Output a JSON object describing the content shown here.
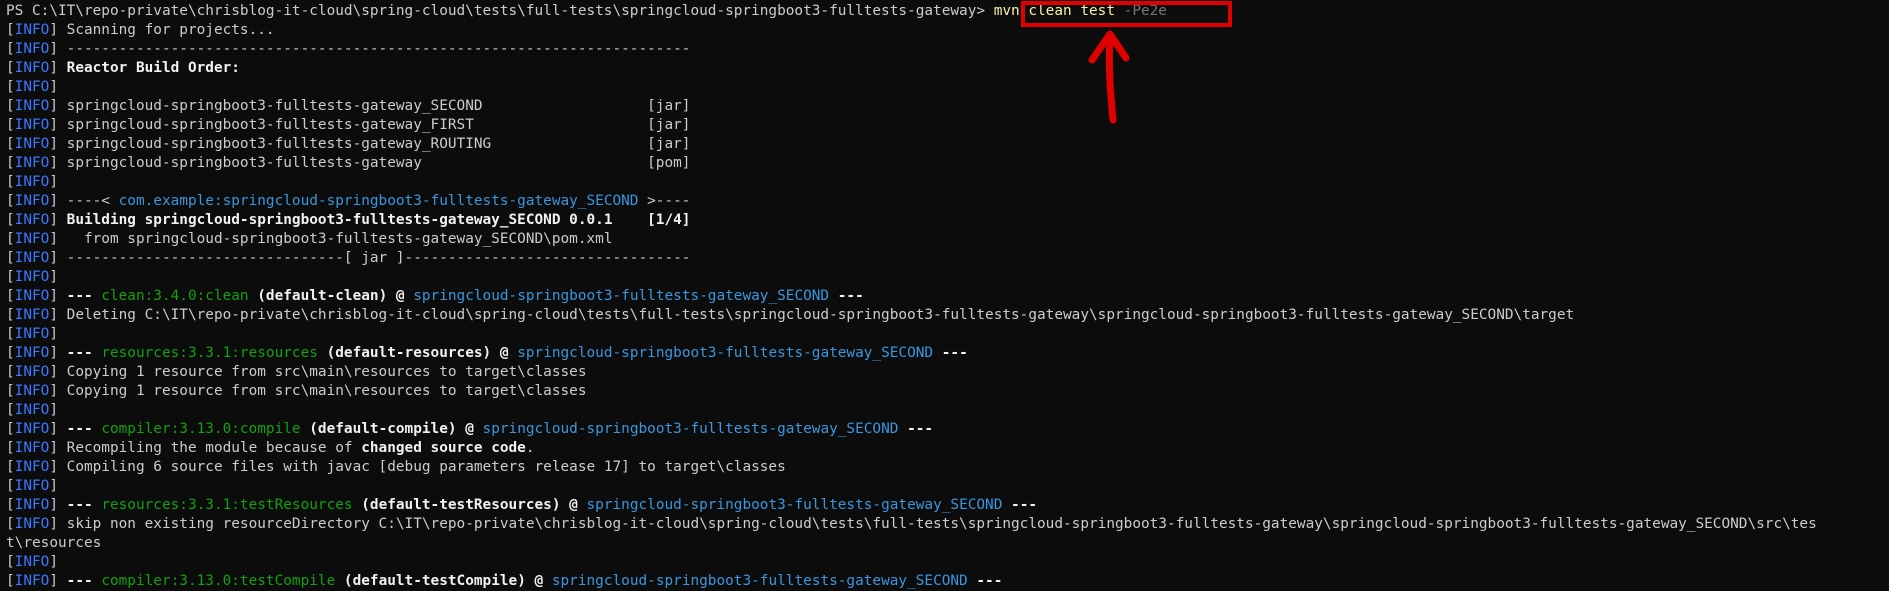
{
  "terminal": {
    "lines": [
      [
        {
          "t": "PS C:\\IT\\repo-private\\chrisblog-it-cloud\\spring-cloud\\tests\\full-tests\\springcloud-springboot3-fulltests-gateway> ",
          "c": "plain"
        },
        {
          "t": "mvn clean test ",
          "c": "cmd"
        },
        {
          "t": "-Pe2e",
          "c": "dim"
        }
      ],
      [
        {
          "t": "[",
          "c": "plain"
        },
        {
          "t": "INFO",
          "c": "info"
        },
        {
          "t": "] Scanning for projects...",
          "c": "plain"
        }
      ],
      [
        {
          "t": "[",
          "c": "plain"
        },
        {
          "t": "INFO",
          "c": "info"
        },
        {
          "t": "] ------------------------------------------------------------------------",
          "c": "plain"
        }
      ],
      [
        {
          "t": "[",
          "c": "plain"
        },
        {
          "t": "INFO",
          "c": "info"
        },
        {
          "t": "] ",
          "c": "plain"
        },
        {
          "t": "Reactor Build Order:",
          "c": "bold"
        }
      ],
      [
        {
          "t": "[",
          "c": "plain"
        },
        {
          "t": "INFO",
          "c": "info"
        },
        {
          "t": "]",
          "c": "plain"
        }
      ],
      [
        {
          "t": "[",
          "c": "plain"
        },
        {
          "t": "INFO",
          "c": "info"
        },
        {
          "t": "] springcloud-springboot3-fulltests-gateway_SECOND                   [jar]",
          "c": "plain"
        }
      ],
      [
        {
          "t": "[",
          "c": "plain"
        },
        {
          "t": "INFO",
          "c": "info"
        },
        {
          "t": "] springcloud-springboot3-fulltests-gateway_FIRST                    [jar]",
          "c": "plain"
        }
      ],
      [
        {
          "t": "[",
          "c": "plain"
        },
        {
          "t": "INFO",
          "c": "info"
        },
        {
          "t": "] springcloud-springboot3-fulltests-gateway_ROUTING                  [jar]",
          "c": "plain"
        }
      ],
      [
        {
          "t": "[",
          "c": "plain"
        },
        {
          "t": "INFO",
          "c": "info"
        },
        {
          "t": "] springcloud-springboot3-fulltests-gateway                          [pom]",
          "c": "plain"
        }
      ],
      [
        {
          "t": "[",
          "c": "plain"
        },
        {
          "t": "INFO",
          "c": "info"
        },
        {
          "t": "]",
          "c": "plain"
        }
      ],
      [
        {
          "t": "[",
          "c": "plain"
        },
        {
          "t": "INFO",
          "c": "info"
        },
        {
          "t": "] ----< ",
          "c": "plain"
        },
        {
          "t": "com.example:springcloud-springboot3-fulltests-gateway_SECOND",
          "c": "cyan"
        },
        {
          "t": " >----",
          "c": "plain"
        }
      ],
      [
        {
          "t": "[",
          "c": "plain"
        },
        {
          "t": "INFO",
          "c": "info"
        },
        {
          "t": "] ",
          "c": "plain"
        },
        {
          "t": "Building springcloud-springboot3-fulltests-gateway_SECOND 0.0.1    [1/4]",
          "c": "bold"
        }
      ],
      [
        {
          "t": "[",
          "c": "plain"
        },
        {
          "t": "INFO",
          "c": "info"
        },
        {
          "t": "]   from springcloud-springboot3-fulltests-gateway_SECOND\\pom.xml",
          "c": "plain"
        }
      ],
      [
        {
          "t": "[",
          "c": "plain"
        },
        {
          "t": "INFO",
          "c": "info"
        },
        {
          "t": "] --------------------------------[ jar ]---------------------------------",
          "c": "plain"
        }
      ],
      [
        {
          "t": "[",
          "c": "plain"
        },
        {
          "t": "INFO",
          "c": "info"
        },
        {
          "t": "]",
          "c": "plain"
        }
      ],
      [
        {
          "t": "[",
          "c": "plain"
        },
        {
          "t": "INFO",
          "c": "info"
        },
        {
          "t": "] ",
          "c": "plain"
        },
        {
          "t": "--- ",
          "c": "bold"
        },
        {
          "t": "clean:3.4.0:clean",
          "c": "green"
        },
        {
          "t": " (default-clean)",
          "c": "bold"
        },
        {
          "t": " @ ",
          "c": "bold"
        },
        {
          "t": "springcloud-springboot3-fulltests-gateway_SECOND",
          "c": "cyan"
        },
        {
          "t": " ---",
          "c": "bold"
        }
      ],
      [
        {
          "t": "[",
          "c": "plain"
        },
        {
          "t": "INFO",
          "c": "info"
        },
        {
          "t": "] Deleting C:\\IT\\repo-private\\chrisblog-it-cloud\\spring-cloud\\tests\\full-tests\\springcloud-springboot3-fulltests-gateway\\springcloud-springboot3-fulltests-gateway_SECOND\\target",
          "c": "plain"
        }
      ],
      [
        {
          "t": "[",
          "c": "plain"
        },
        {
          "t": "INFO",
          "c": "info"
        },
        {
          "t": "]",
          "c": "plain"
        }
      ],
      [
        {
          "t": "[",
          "c": "plain"
        },
        {
          "t": "INFO",
          "c": "info"
        },
        {
          "t": "] ",
          "c": "plain"
        },
        {
          "t": "--- ",
          "c": "bold"
        },
        {
          "t": "resources:3.3.1:resources",
          "c": "green"
        },
        {
          "t": " (default-resources)",
          "c": "bold"
        },
        {
          "t": " @ ",
          "c": "bold"
        },
        {
          "t": "springcloud-springboot3-fulltests-gateway_SECOND",
          "c": "cyan"
        },
        {
          "t": " ---",
          "c": "bold"
        }
      ],
      [
        {
          "t": "[",
          "c": "plain"
        },
        {
          "t": "INFO",
          "c": "info"
        },
        {
          "t": "] Copying 1 resource from src\\main\\resources to target\\classes",
          "c": "plain"
        }
      ],
      [
        {
          "t": "[",
          "c": "plain"
        },
        {
          "t": "INFO",
          "c": "info"
        },
        {
          "t": "] Copying 1 resource from src\\main\\resources to target\\classes",
          "c": "plain"
        }
      ],
      [
        {
          "t": "[",
          "c": "plain"
        },
        {
          "t": "INFO",
          "c": "info"
        },
        {
          "t": "]",
          "c": "plain"
        }
      ],
      [
        {
          "t": "[",
          "c": "plain"
        },
        {
          "t": "INFO",
          "c": "info"
        },
        {
          "t": "] ",
          "c": "plain"
        },
        {
          "t": "--- ",
          "c": "bold"
        },
        {
          "t": "compiler:3.13.0:compile",
          "c": "green"
        },
        {
          "t": " (default-compile)",
          "c": "bold"
        },
        {
          "t": " @ ",
          "c": "bold"
        },
        {
          "t": "springcloud-springboot3-fulltests-gateway_SECOND",
          "c": "cyan"
        },
        {
          "t": " ---",
          "c": "bold"
        }
      ],
      [
        {
          "t": "[",
          "c": "plain"
        },
        {
          "t": "INFO",
          "c": "info"
        },
        {
          "t": "] Recompiling the module because of ",
          "c": "plain"
        },
        {
          "t": "changed source code",
          "c": "bold"
        },
        {
          "t": ".",
          "c": "plain"
        }
      ],
      [
        {
          "t": "[",
          "c": "plain"
        },
        {
          "t": "INFO",
          "c": "info"
        },
        {
          "t": "] Compiling 6 source files with javac [debug parameters release 17] to target\\classes",
          "c": "plain"
        }
      ],
      [
        {
          "t": "[",
          "c": "plain"
        },
        {
          "t": "INFO",
          "c": "info"
        },
        {
          "t": "]",
          "c": "plain"
        }
      ],
      [
        {
          "t": "[",
          "c": "plain"
        },
        {
          "t": "INFO",
          "c": "info"
        },
        {
          "t": "] ",
          "c": "plain"
        },
        {
          "t": "--- ",
          "c": "bold"
        },
        {
          "t": "resources:3.3.1:testResources",
          "c": "green"
        },
        {
          "t": " (default-testResources)",
          "c": "bold"
        },
        {
          "t": " @ ",
          "c": "bold"
        },
        {
          "t": "springcloud-springboot3-fulltests-gateway_SECOND",
          "c": "cyan"
        },
        {
          "t": " ---",
          "c": "bold"
        }
      ],
      [
        {
          "t": "[",
          "c": "plain"
        },
        {
          "t": "INFO",
          "c": "info"
        },
        {
          "t": "] skip non existing resourceDirectory C:\\IT\\repo-private\\chrisblog-it-cloud\\spring-cloud\\tests\\full-tests\\springcloud-springboot3-fulltests-gateway\\springcloud-springboot3-fulltests-gateway_SECOND\\src\\tes",
          "c": "plain"
        }
      ],
      [
        {
          "t": "t\\resources",
          "c": "plain"
        }
      ],
      [
        {
          "t": "[",
          "c": "plain"
        },
        {
          "t": "INFO",
          "c": "info"
        },
        {
          "t": "]",
          "c": "plain"
        }
      ],
      [
        {
          "t": "[",
          "c": "plain"
        },
        {
          "t": "INFO",
          "c": "info"
        },
        {
          "t": "] ",
          "c": "plain"
        },
        {
          "t": "--- ",
          "c": "bold"
        },
        {
          "t": "compiler:3.13.0:testCompile",
          "c": "green"
        },
        {
          "t": " (default-testCompile)",
          "c": "bold"
        },
        {
          "t": " @ ",
          "c": "bold"
        },
        {
          "t": "springcloud-springboot3-fulltests-gateway_SECOND",
          "c": "cyan"
        },
        {
          "t": " ---",
          "c": "bold"
        }
      ]
    ]
  },
  "annotation": {
    "highlight_color": "#e00000",
    "highlighted_text": "mvn clean test -Pe2e",
    "arrow_icon": "up-arrow-icon"
  }
}
